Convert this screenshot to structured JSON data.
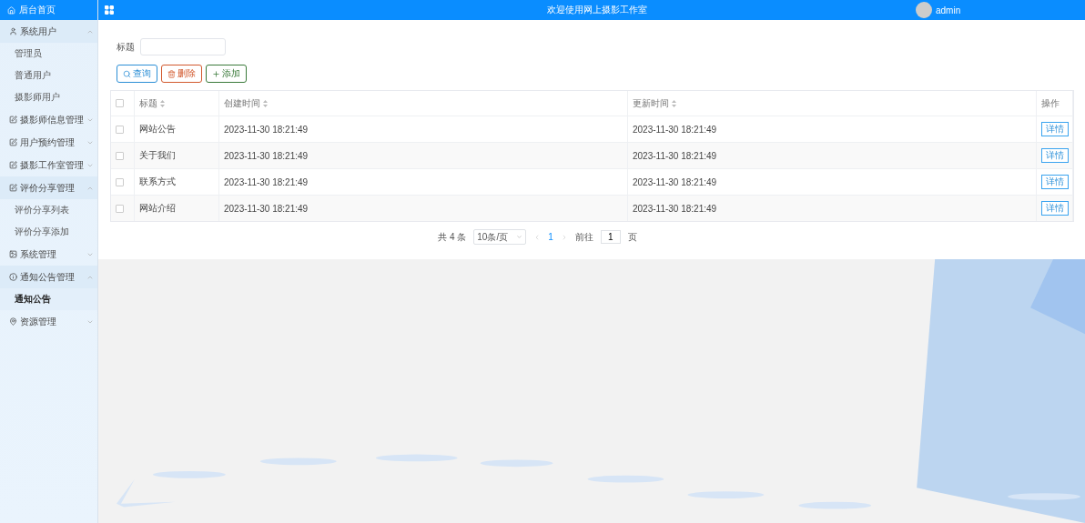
{
  "sidebar": {
    "home": {
      "label": "后台首页",
      "selected": true
    },
    "groups": [
      {
        "label": "系统用户",
        "expanded": true,
        "children": [
          {
            "label": "管理员",
            "selected": false
          },
          {
            "label": "普通用户",
            "selected": false
          },
          {
            "label": "摄影师用户",
            "selected": false
          }
        ]
      },
      {
        "label": "摄影师信息管理",
        "expanded": false
      },
      {
        "label": "用户预约管理",
        "expanded": false
      },
      {
        "label": "摄影工作室管理",
        "expanded": false
      },
      {
        "label": "评价分享管理",
        "expanded": true,
        "children": [
          {
            "label": "评价分享列表",
            "selected": false
          },
          {
            "label": "评价分享添加",
            "selected": false
          }
        ]
      },
      {
        "label": "系统管理",
        "expanded": false
      },
      {
        "label": "通知公告管理",
        "expanded": true,
        "children": [
          {
            "label": "通知公告",
            "selected": true
          }
        ]
      },
      {
        "label": "资源管理",
        "expanded": false
      }
    ]
  },
  "topbar": {
    "title": "欢迎使用网上摄影工作室",
    "user": "admin"
  },
  "filter": {
    "label": "标题"
  },
  "buttons": [
    {
      "kind": "search",
      "label": "查询"
    },
    {
      "kind": "delete",
      "label": "删除"
    },
    {
      "kind": "add",
      "label": "添加"
    }
  ],
  "table": {
    "all_checked": false,
    "columns": [
      {
        "label": "标题",
        "sortable": true
      },
      {
        "label": "创建时间",
        "sortable": true
      },
      {
        "label": "更新时间",
        "sortable": true
      },
      {
        "label": "操作",
        "sortable": false
      }
    ],
    "rows": [
      {
        "title": "网站公告",
        "created": "2023-11-30 18:21:49",
        "updated": "2023-11-30 18:21:49",
        "action": "详情",
        "checked": false
      },
      {
        "title": "关于我们",
        "created": "2023-11-30 18:21:49",
        "updated": "2023-11-30 18:21:49",
        "action": "详情",
        "checked": false
      },
      {
        "title": "联系方式",
        "created": "2023-11-30 18:21:49",
        "updated": "2023-11-30 18:21:49",
        "action": "详情",
        "checked": false
      },
      {
        "title": "网站介绍",
        "created": "2023-11-30 18:21:49",
        "updated": "2023-11-30 18:21:49",
        "action": "详情",
        "checked": false
      }
    ]
  },
  "pagination": {
    "total": "共 4 条",
    "page_size": "10条/页",
    "pages": [
      {
        "label": "1",
        "selected": true
      }
    ],
    "goto_label": "前往",
    "goto_value": "1",
    "goto_suffix": "页"
  }
}
